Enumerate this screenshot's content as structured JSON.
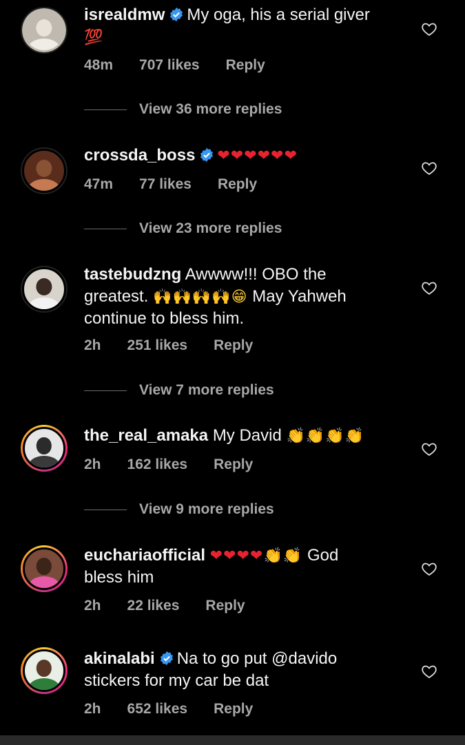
{
  "comments": [
    {
      "username": "isrealdmw",
      "verified": true,
      "text": "My oga, his a serial giver",
      "emoji": "💯",
      "time": "48m",
      "likes": "707 likes",
      "reply": "Reply",
      "view_replies": "View 36 more replies"
    },
    {
      "username": "crossda_boss",
      "verified": true,
      "text": "",
      "emoji": "❤❤❤❤❤❤",
      "time": "47m",
      "likes": "77 likes",
      "reply": "Reply",
      "view_replies": "View 23 more replies"
    },
    {
      "username": "tastebudzng",
      "verified": false,
      "text_1": "Awwww!!! OBO the",
      "text_2": "greatest.",
      "emoji": "🙌🙌🙌🙌😁",
      "text_3": "May Yahweh",
      "text_4": "continue to bless him.",
      "time": "2h",
      "likes": "251 likes",
      "reply": "Reply",
      "view_replies": "View 7 more replies"
    },
    {
      "username": "the_real_amaka",
      "verified": false,
      "text": "My David",
      "emoji": "👏👏👏👏",
      "time": "2h",
      "likes": "162 likes",
      "reply": "Reply",
      "view_replies": "View 9 more replies"
    },
    {
      "username": "euchariaofficial",
      "verified": false,
      "emoji": "❤❤❤❤👏👏",
      "text_1": "God",
      "text_2": "bless him",
      "time": "2h",
      "likes": "22 likes",
      "reply": "Reply"
    },
    {
      "username": "akinalabi",
      "verified": true,
      "text_1": "Na to go put @davido",
      "text_2": "stickers for my car be dat",
      "time": "2h",
      "likes": "652 likes",
      "reply": "Reply"
    }
  ],
  "icons": {
    "like": "heart-icon",
    "verified": "verified-badge-icon"
  },
  "colors": {
    "background": "#000000",
    "secondary_text": "#a8a8a8",
    "verified_blue": "#3897f0",
    "heart_red": "#e8232f"
  }
}
